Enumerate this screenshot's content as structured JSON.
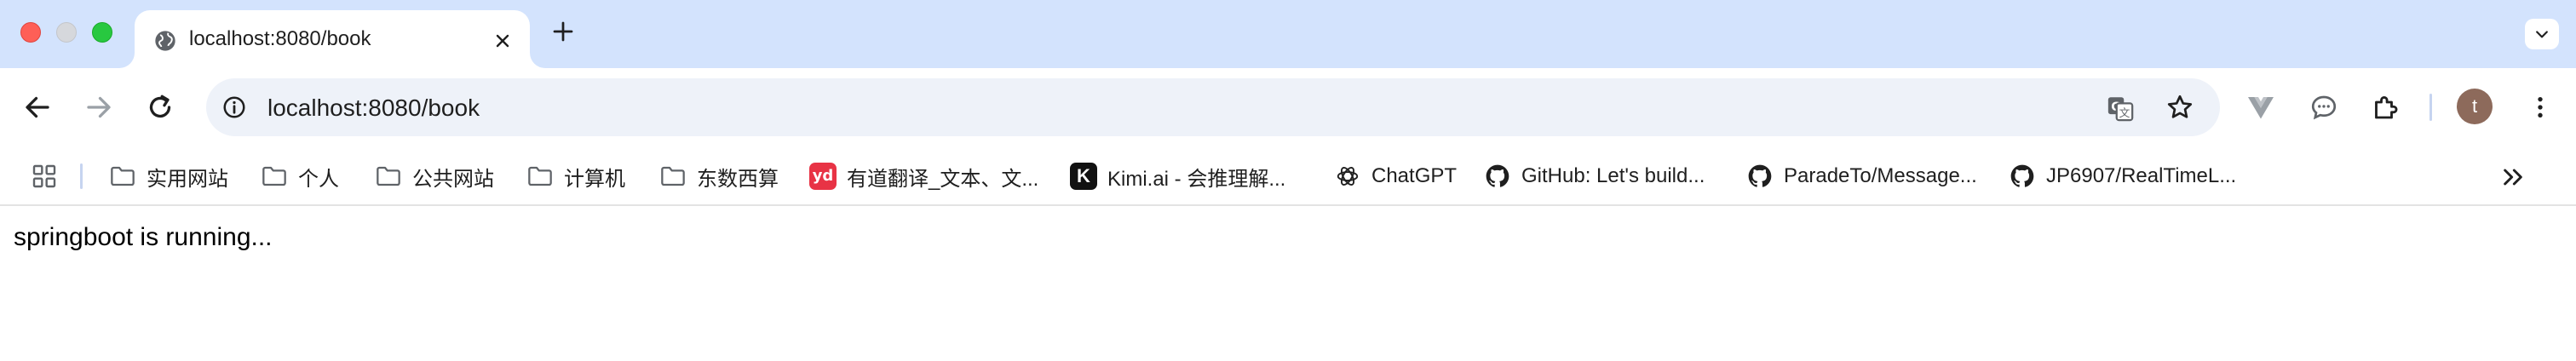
{
  "browser": {
    "tab": {
      "title": "localhost:8080/book",
      "favicon": "globe-icon"
    },
    "address_bar": {
      "url": "localhost:8080/book"
    },
    "profile": {
      "initial": "t",
      "color": "#8d6a5b"
    },
    "bookmarks": [
      {
        "label": "实用网站",
        "icon": "folder-icon"
      },
      {
        "label": "个人",
        "icon": "folder-icon"
      },
      {
        "label": "公共网站",
        "icon": "folder-icon"
      },
      {
        "label": "计算机",
        "icon": "folder-icon"
      },
      {
        "label": "东数西算",
        "icon": "folder-icon"
      },
      {
        "label": "有道翻译_文本、文...",
        "icon": "youdao-icon",
        "icon_text": "yd",
        "color": "#e83345"
      },
      {
        "label": "Kimi.ai - 会推理解...",
        "icon": "kimi-icon",
        "icon_text": "K"
      },
      {
        "label": "ChatGPT",
        "icon": "openai-icon"
      },
      {
        "label": "GitHub: Let's build...",
        "icon": "github-icon"
      },
      {
        "label": "ParadeTo/Message...",
        "icon": "github-icon"
      },
      {
        "label": "JP6907/RealTimeL...",
        "icon": "github-icon"
      }
    ]
  },
  "page": {
    "body_text": "springboot is running..."
  },
  "colors": {
    "tabstrip": "#d3e3fd",
    "omnibox": "#eef2f9",
    "close": "#fe5f57",
    "maximize": "#28c840"
  }
}
